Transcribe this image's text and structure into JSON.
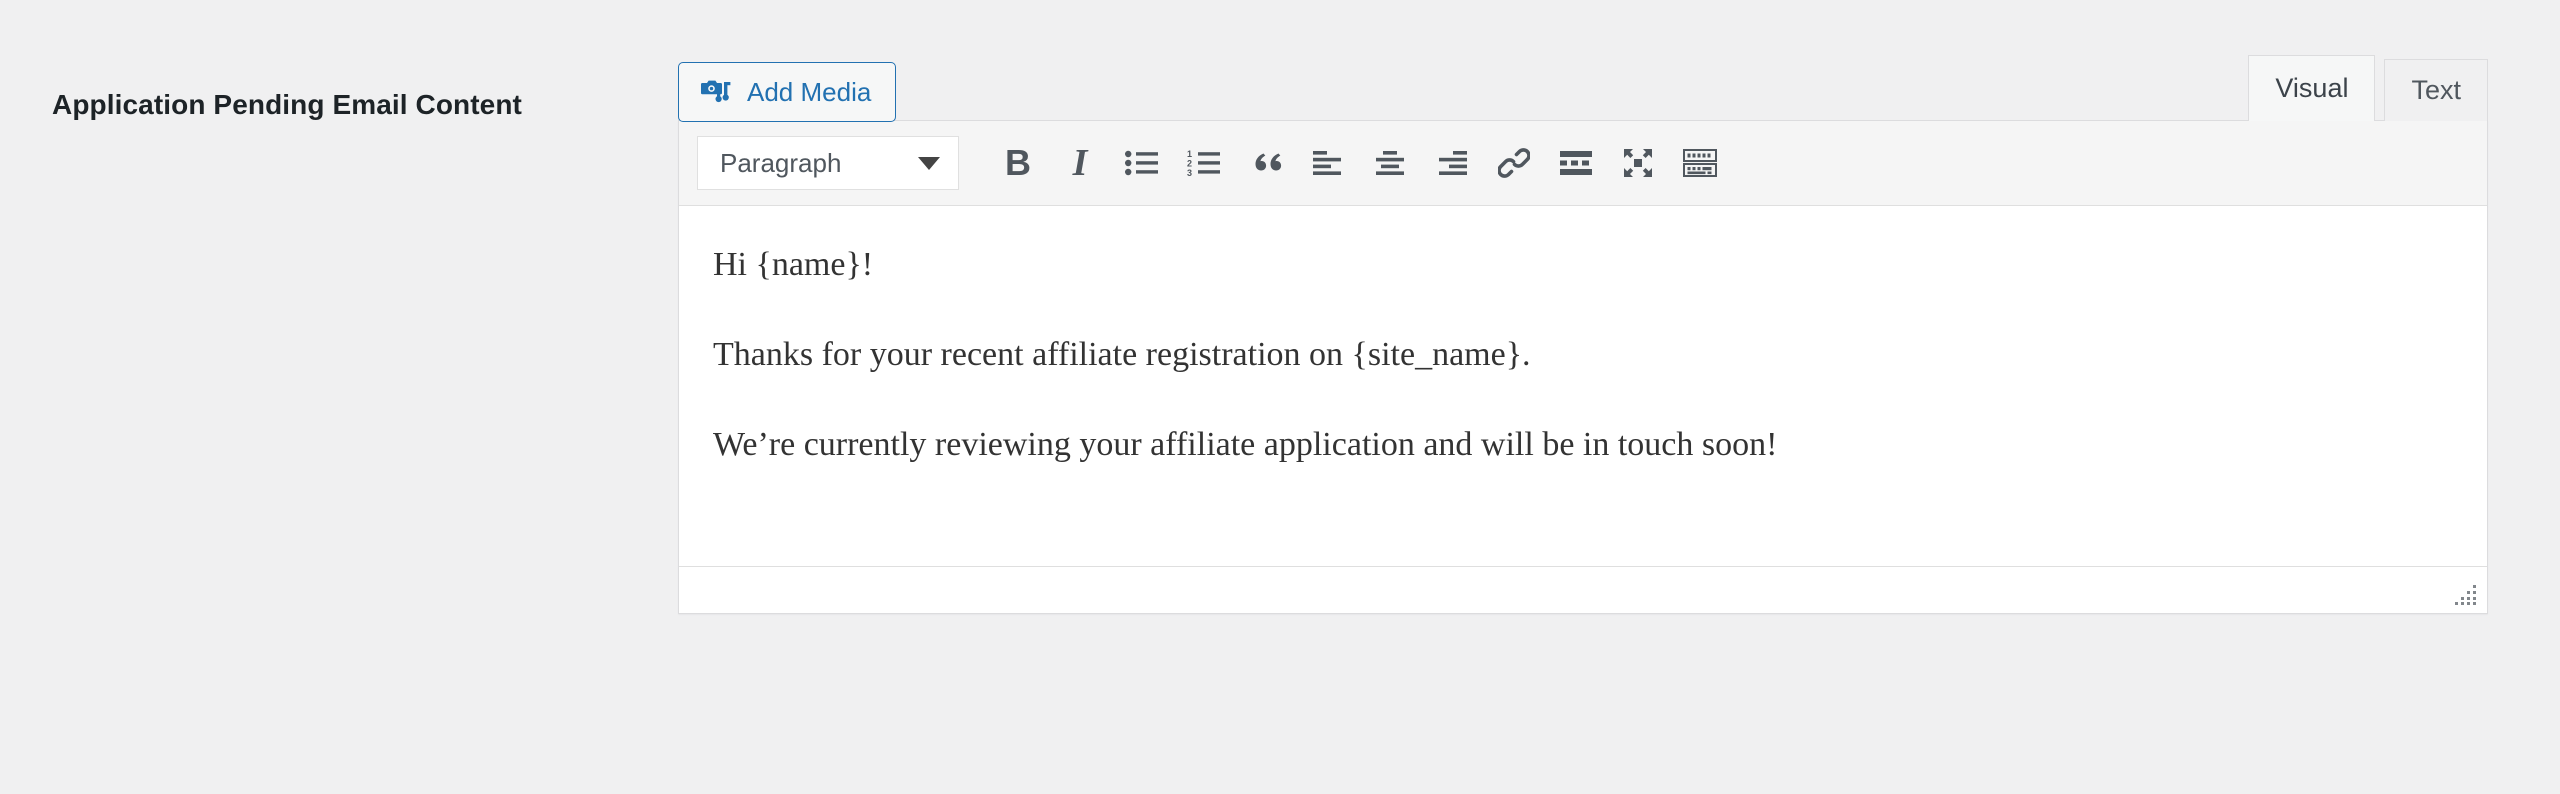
{
  "field": {
    "label": "Application Pending Email Content"
  },
  "toolbar_top": {
    "add_media_label": "Add Media",
    "add_media_icon": "media-camera-music-icon",
    "tabs": [
      {
        "label": "Visual",
        "name": "tab-visual",
        "active": true
      },
      {
        "label": "Text",
        "name": "tab-text",
        "active": false
      }
    ]
  },
  "editor_toolbar": {
    "format_select_value": "Paragraph",
    "format_select_caret": "chevron-down-icon",
    "buttons": [
      {
        "name": "bold-button",
        "icon": "bold-icon",
        "label": "B"
      },
      {
        "name": "italic-button",
        "icon": "italic-icon",
        "label": "I"
      },
      {
        "name": "bulleted-list-button",
        "icon": "bulleted-list-icon",
        "label": ""
      },
      {
        "name": "numbered-list-button",
        "icon": "numbered-list-icon",
        "label": ""
      },
      {
        "name": "blockquote-button",
        "icon": "blockquote-icon",
        "label": ""
      },
      {
        "name": "align-left-button",
        "icon": "align-left-icon",
        "label": ""
      },
      {
        "name": "align-center-button",
        "icon": "align-center-icon",
        "label": ""
      },
      {
        "name": "align-right-button",
        "icon": "align-right-icon",
        "label": ""
      },
      {
        "name": "insert-link-button",
        "icon": "link-icon",
        "label": ""
      },
      {
        "name": "read-more-button",
        "icon": "read-more-icon",
        "label": ""
      },
      {
        "name": "fullscreen-button",
        "icon": "fullscreen-arrows-icon",
        "label": ""
      },
      {
        "name": "toolbar-toggle-button",
        "icon": "kitchen-sink-icon",
        "label": ""
      }
    ]
  },
  "editor_content": {
    "paragraphs": [
      "Hi {name}!",
      "Thanks for your recent affiliate registration on {site_name}.",
      "We’re currently reviewing your affiliate application and will be in touch soon!"
    ]
  },
  "statusbar": {
    "resize_handle_icon": "resize-grip-icon"
  },
  "colors": {
    "page_background": "#f0f0f1",
    "accent_blue": "#2271b1",
    "label_text": "#1d2327",
    "toolbar_background": "#f5f5f5",
    "icon_color": "#50575e",
    "body_text": "#333333",
    "border": "#dcdcde"
  }
}
